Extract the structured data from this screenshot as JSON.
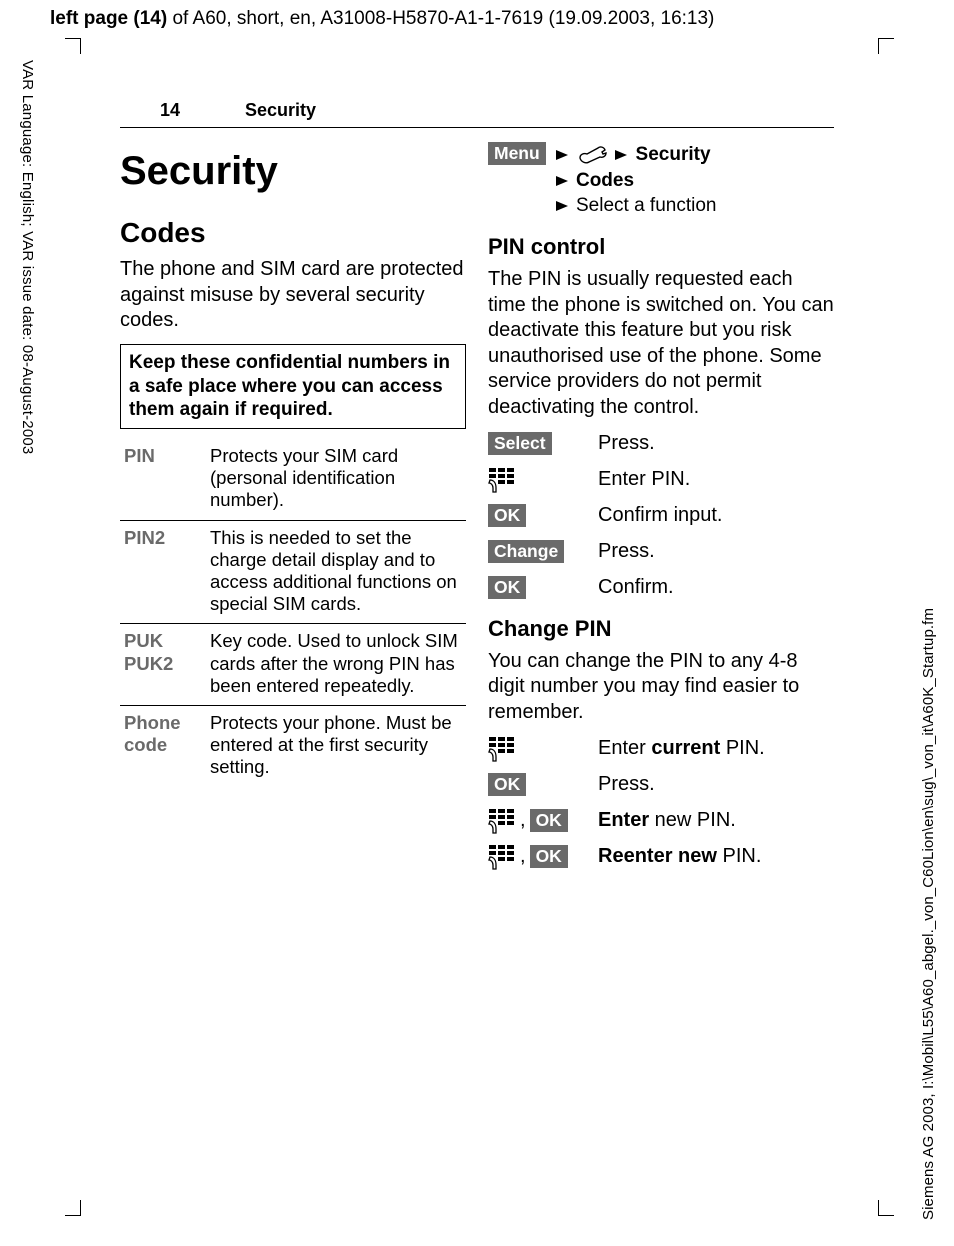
{
  "meta": {
    "header_prefix": "left page (14)",
    "header_rest": " of A60, short, en, A31008-H5870-A1-1-7619 (19.09.2003, 16:13)",
    "side_left": "VAR Language: English; VAR issue date: 08-August-2003",
    "side_right": "Siemens AG 2003, I:\\Mobil\\L55\\A60_abgel._von_C60Lion\\en\\sug\\_von_it\\A60K_Startup.fm"
  },
  "running_head": {
    "page_num": "14",
    "title": "Security"
  },
  "left": {
    "h1": "Security",
    "h2": "Codes",
    "intro": "The phone and SIM card are protected against misuse by several security codes.",
    "note": "Keep these confidential numbers in a safe place where you can access them again if required.",
    "table": [
      {
        "label": "PIN",
        "desc": "Protects your SIM card (personal identification number)."
      },
      {
        "label": "PIN2",
        "desc": "This is needed to set the charge detail display and to access additional functions on special SIM cards."
      },
      {
        "label": "PUK\nPUK2",
        "desc": "Key code. Used to unlock SIM cards after the wrong PIN has been entered repeatedly."
      },
      {
        "label": "Phone code",
        "desc": "Protects your phone. Must be entered at the first security setting."
      }
    ]
  },
  "right": {
    "menu_key": "Menu",
    "nav": {
      "security": "Security",
      "codes": "Codes",
      "select_fn": "Select a function"
    },
    "pin_control": {
      "title": "PIN control",
      "body": "The PIN is usually requested each time the phone is switched on. You can deactivate this feature but you risk unauthorised use of the phone. Some service providers do not permit deactivating the control.",
      "steps": [
        {
          "key": "Select",
          "txt": "Press."
        },
        {
          "key": "keypad",
          "txt": "Enter PIN."
        },
        {
          "key": "OK",
          "txt": "Confirm input."
        },
        {
          "key": "Change",
          "txt": "Press."
        },
        {
          "key": "OK",
          "txt": "Confirm."
        }
      ]
    },
    "change_pin": {
      "title": "Change PIN",
      "body": "You can change the PIN to any 4-8 digit number you may find easier to remember.",
      "steps": [
        {
          "key": "keypad",
          "txt_html": "Enter <b>current</b> PIN."
        },
        {
          "key": "OK",
          "txt_html": "Press."
        },
        {
          "key": "keypad,OK",
          "txt_html": "<b>Enter</b>  new PIN."
        },
        {
          "key": "keypad,OK",
          "txt_html": "<b>Reenter new</b> PIN."
        }
      ]
    }
  }
}
